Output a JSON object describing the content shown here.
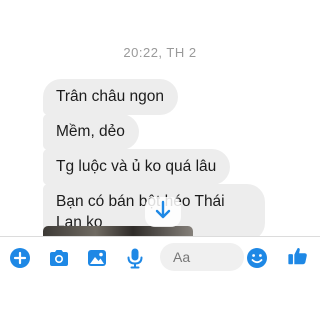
{
  "colors": {
    "accent": "#1e88e5",
    "bubble_bg": "#ededed",
    "text": "#1c1c1c",
    "timestamp": "#9a9a9a"
  },
  "chat": {
    "timestamp": "20:22, TH 2",
    "messages": [
      {
        "text": "Trân châu ngon"
      },
      {
        "text": "Mềm, dẻo"
      },
      {
        "text": "Tg luộc và ủ ko quá lâu"
      },
      {
        "text": "Bạn có bán bột héo Thái Lan ko"
      }
    ],
    "scroll_down_icon": "arrow-down-icon"
  },
  "composer": {
    "placeholder": "Aa",
    "icons": [
      "plus-icon",
      "camera-icon",
      "image-icon",
      "microphone-icon",
      "emoji-icon",
      "thumbs-up-icon"
    ]
  }
}
